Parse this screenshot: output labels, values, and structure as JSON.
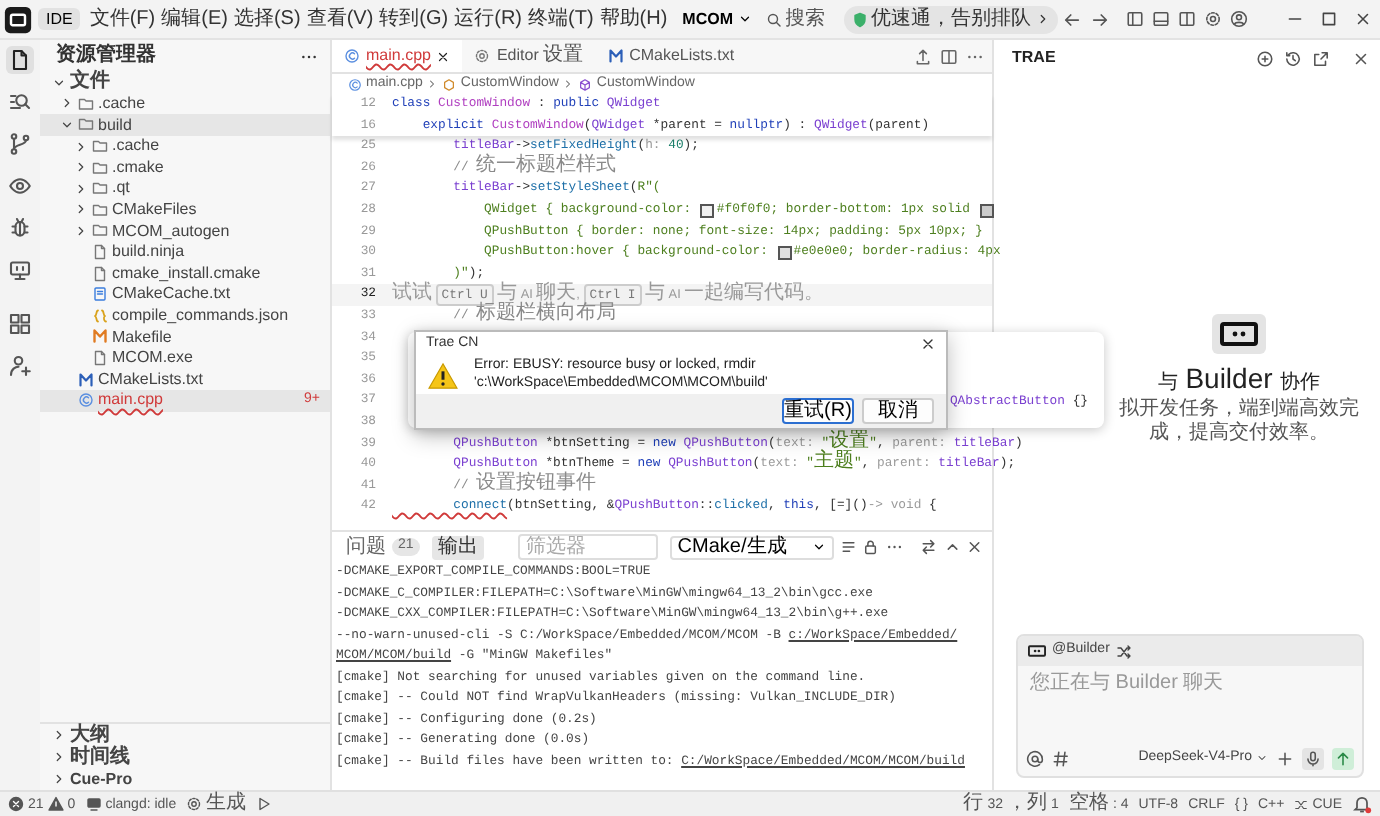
{
  "title_bar": {
    "app_label": "IDE",
    "menus": [
      "文件(F)",
      "编辑(E)",
      "选择(S)",
      "查看(V)",
      "转到(G)",
      "运行(R)",
      "终端(T)",
      "帮助(H)"
    ],
    "project": "MCOM",
    "search_placeholder": "搜索",
    "promo": "优速通，告别排队"
  },
  "activity_bar": [
    {
      "selected": true
    },
    {
      "selected": false
    },
    {
      "selected": false
    },
    {
      "selected": false
    },
    {
      "selected": false
    },
    {
      "selected": false
    },
    {
      "selected": false
    },
    {
      "selected": false
    }
  ],
  "sidebar": {
    "title": "资源管理器",
    "section": "文件",
    "tree": [
      {
        "label": ".cache",
        "kind": "folder",
        "expanded": false,
        "selected": false
      },
      {
        "label": "build",
        "kind": "folder",
        "expanded": true,
        "selected": true,
        "children": [
          {
            "label": ".cache",
            "kind": "folder",
            "expanded": false,
            "selected": false
          },
          {
            "label": ".cmake",
            "kind": "folder",
            "expanded": false,
            "selected": false
          },
          {
            "label": ".qt",
            "kind": "folder",
            "expanded": false,
            "selected": false
          },
          {
            "label": "CMakeFiles",
            "kind": "folder",
            "expanded": false,
            "selected": false
          },
          {
            "label": "MCOM_autogen",
            "kind": "folder",
            "expanded": false,
            "selected": false
          },
          {
            "label": "build.ninja",
            "kind": "plain",
            "selected": false
          },
          {
            "label": "cmake_install.cmake",
            "kind": "plain",
            "selected": false
          },
          {
            "label": "CMakeCache.txt",
            "kind": "cache",
            "selected": false
          },
          {
            "label": "compile_commands.json",
            "kind": "json",
            "selected": false
          },
          {
            "label": "Makefile",
            "kind": "make",
            "selected": false
          },
          {
            "label": "MCOM.exe",
            "kind": "plain",
            "selected": false
          }
        ]
      },
      {
        "label": "CMakeLists.txt",
        "kind": "cmake",
        "selected": false
      },
      {
        "label": "main.cpp",
        "kind": "cpp",
        "selected": true,
        "error": true,
        "badge": "9+"
      }
    ],
    "panels": [
      "大纲",
      "时间线",
      "Cue-Pro"
    ]
  },
  "editor": {
    "tabs": [
      {
        "label": "main.cpp",
        "kind": "cpp",
        "selected": true,
        "error": true
      },
      {
        "label": "Editor 设置",
        "kind": "settings",
        "selected": false,
        "error": false
      },
      {
        "label": "CMakeLists.txt",
        "kind": "cmake",
        "selected": false,
        "error": false
      }
    ],
    "breadcrumb": [
      "main.cpp",
      "CustomWindow",
      "CustomWindow"
    ],
    "sticky_lines": [
      {
        "number": "12",
        "segments": [
          {
            "text": "class ",
            "kind": "kw"
          },
          {
            "text": "CustomWindow",
            "kind": "cls"
          },
          {
            "text": " : ",
            "kind": "plain"
          },
          {
            "text": "public ",
            "kind": "kw"
          },
          {
            "text": "QWidget",
            "kind": "type"
          }
        ]
      },
      {
        "number": "16",
        "segments": [
          {
            "text": "    explicit ",
            "kind": "kw"
          },
          {
            "text": "CustomWindow",
            "kind": "cls"
          },
          {
            "text": "(",
            "kind": "plain"
          },
          {
            "text": "QWidget",
            "kind": "type"
          },
          {
            "text": " *parent = ",
            "kind": "plain"
          },
          {
            "text": "nullptr",
            "kind": "kw"
          },
          {
            "text": ") : ",
            "kind": "plain"
          },
          {
            "text": "QWidget",
            "kind": "type"
          },
          {
            "text": "(parent)",
            "kind": "plain"
          }
        ]
      }
    ],
    "lines": [
      {
        "number": "25",
        "current": false,
        "segments": [
          {
            "text": "        titleBar",
            "kind": "var"
          },
          {
            "text": "->",
            "kind": "plain"
          },
          {
            "text": "setFixedHeight",
            "kind": "fn"
          },
          {
            "text": "(",
            "kind": "plain"
          },
          {
            "text": "h: ",
            "kind": "hint"
          },
          {
            "text": "40",
            "kind": "num"
          },
          {
            "text": ");",
            "kind": "plain"
          }
        ]
      },
      {
        "number": "26",
        "current": false,
        "segments": [
          {
            "text": "        // 统一标题栏样式",
            "kind": "comment"
          }
        ]
      },
      {
        "number": "27",
        "current": false,
        "segments": [
          {
            "text": "        titleBar",
            "kind": "var"
          },
          {
            "text": "->",
            "kind": "plain"
          },
          {
            "text": "setStyleSheet",
            "kind": "fn"
          },
          {
            "text": "(",
            "kind": "plain"
          },
          {
            "text": "R\"(",
            "kind": "str"
          }
        ]
      },
      {
        "number": "28",
        "current": false,
        "segments": [
          {
            "text": "            QWidget { background-color: ",
            "kind": "str"
          },
          {
            "kind": "swatch",
            "color": "#f0f0f0"
          },
          {
            "text": "#f0f0f0; border-bottom: 1px solid ",
            "kind": "str"
          },
          {
            "kind": "swatch",
            "color": "#cccccc"
          }
        ]
      },
      {
        "number": "29",
        "current": false,
        "segments": [
          {
            "text": "            QPushButton { border: none; font-size: 14px; padding: 5px 10px; }",
            "kind": "str"
          }
        ]
      },
      {
        "number": "30",
        "current": false,
        "segments": [
          {
            "text": "            QPushButton:hover { background-color: ",
            "kind": "str"
          },
          {
            "kind": "swatch",
            "color": "#e0e0e0"
          },
          {
            "text": "#e0e0e0; border-radius: 4px",
            "kind": "str"
          }
        ]
      },
      {
        "number": "31",
        "current": false,
        "segments": [
          {
            "text": "        )\"",
            "kind": "str"
          },
          {
            "text": ");",
            "kind": "plain"
          }
        ]
      },
      {
        "number": "32",
        "current": true,
        "segments": [
          {
            "text": "试试 ",
            "kind": "ghost"
          },
          {
            "text": "Ctrl U",
            "kind": "key"
          },
          {
            "text": " 与 AI 聊天, ",
            "kind": "ghost"
          },
          {
            "text": "Ctrl I",
            "kind": "key"
          },
          {
            "text": " 与 AI 一起编写代码。",
            "kind": "ghost"
          }
        ]
      },
      {
        "number": "33",
        "current": false,
        "segments": [
          {
            "text": "        // 标题栏横向布局",
            "kind": "comment"
          }
        ]
      },
      {
        "number": "34",
        "current": false
      },
      {
        "number": "35",
        "current": false
      },
      {
        "number": "36",
        "current": false
      },
      {
        "number": "37",
        "current": false
      },
      {
        "number": "38",
        "current": false
      },
      {
        "number": "39",
        "current": false,
        "segments": [
          {
            "text": "        QPushButton",
            "kind": "type"
          },
          {
            "text": " *btnSetting = ",
            "kind": "plain"
          },
          {
            "text": "new ",
            "kind": "kw"
          },
          {
            "text": "QPushButton",
            "kind": "type"
          },
          {
            "text": "(",
            "kind": "plain"
          },
          {
            "text": "text: ",
            "kind": "hint"
          },
          {
            "text": "\"设置\"",
            "kind": "str"
          },
          {
            "text": ", ",
            "kind": "plain"
          },
          {
            "text": "parent: ",
            "kind": "hint"
          },
          {
            "text": "titleBar",
            "kind": "var"
          },
          {
            "text": ")",
            "kind": "plain"
          }
        ]
      },
      {
        "number": "40",
        "current": false,
        "segments": [
          {
            "text": "        QPushButton",
            "kind": "type"
          },
          {
            "text": " *btnTheme = ",
            "kind": "plain"
          },
          {
            "text": "new ",
            "kind": "kw"
          },
          {
            "text": "QPushButton",
            "kind": "type"
          },
          {
            "text": "(",
            "kind": "plain"
          },
          {
            "text": "text: ",
            "kind": "hint"
          },
          {
            "text": "\"主题\"",
            "kind": "str"
          },
          {
            "text": ", ",
            "kind": "plain"
          },
          {
            "text": "parent: ",
            "kind": "hint"
          },
          {
            "text": "titleBar",
            "kind": "var"
          },
          {
            "text": ");",
            "kind": "plain"
          }
        ]
      },
      {
        "number": "41",
        "current": false,
        "segments": [
          {
            "text": "        // 设置按钮事件",
            "kind": "comment"
          }
        ]
      },
      {
        "number": "42",
        "current": false,
        "segments": [
          {
            "text": "        connect",
            "kind": "fn",
            "error": true
          },
          {
            "text": "(btnSetting, &",
            "kind": "plain"
          },
          {
            "text": "QPushButton",
            "kind": "type"
          },
          {
            "text": "::",
            "kind": "plain"
          },
          {
            "text": "clicked",
            "kind": "fn"
          },
          {
            "text": ", ",
            "kind": "plain"
          },
          {
            "text": "this",
            "kind": "kw"
          },
          {
            "text": ", [=]()",
            "kind": "plain"
          },
          {
            "text": "-> void",
            "kind": "hint"
          },
          {
            "text": " {",
            "kind": "plain"
          }
        ]
      }
    ],
    "peek": [
      {
        "text": "QAbstractButton",
        "kind": "type"
      },
      {
        "text": " {}",
        "kind": "plain"
      }
    ]
  },
  "dialog": {
    "title": "Trae CN",
    "message": [
      "Error: EBUSY: resource busy or locked, rmdir",
      "'c:\\WorkSpace\\Embedded\\MCOM\\MCOM\\build'"
    ],
    "buttons": [
      {
        "label": "重试(R)",
        "default": true
      },
      {
        "label": "取消",
        "default": false
      }
    ]
  },
  "panel": {
    "tabs": [
      {
        "label": "问题",
        "count": "21",
        "selected": false
      },
      {
        "label": "输出",
        "selected": true
      }
    ],
    "filter_placeholder": "筛选器",
    "channel": "CMake/生成",
    "output": [
      [
        {
          "text": "-DCMAKE_EXPORT_COMPILE_COMMANDS:BOOL=TRUE",
          "link": false
        }
      ],
      [
        {
          "text": "-DCMAKE_C_COMPILER:FILEPATH=C:\\Software\\MinGW\\mingw64_13_2\\bin\\gcc.exe",
          "link": false
        }
      ],
      [
        {
          "text": "-DCMAKE_CXX_COMPILER:FILEPATH=C:\\Software\\MinGW\\mingw64_13_2\\bin\\g++.exe",
          "link": false
        }
      ],
      [
        {
          "text": "--no-warn-unused-cli -S C:/WorkSpace/Embedded/MCOM/MCOM -B ",
          "link": false
        },
        {
          "text": "c:/WorkSpace/Embedded/",
          "link": true
        }
      ],
      [
        {
          "text": "MCOM/MCOM/build",
          "link": true
        },
        {
          "text": " -G \"MinGW Makefiles\"",
          "link": false
        }
      ],
      [
        {
          "text": "[cmake] Not searching for unused variables given on the command line.",
          "link": false
        }
      ],
      [
        {
          "text": "[cmake] -- Could NOT find WrapVulkanHeaders (missing: Vulkan_INCLUDE_DIR)",
          "link": false
        }
      ],
      [
        {
          "text": "[cmake] -- Configuring done (0.2s)",
          "link": false
        }
      ],
      [
        {
          "text": "[cmake] -- Generating done (0.0s)",
          "link": false
        }
      ],
      [
        {
          "text": "[cmake] -- Build files have been written to: ",
          "link": false
        },
        {
          "text": "C:/WorkSpace/Embedded/MCOM/MCOM/build",
          "link": true
        }
      ]
    ]
  },
  "assistant": {
    "title": "TRAE",
    "heading": "与 Builder 协作",
    "description": "拟开发任务，端到端高效完成，提高交付效率。",
    "chat": {
      "agent": "@Builder",
      "placeholder": "您正在与 Builder 聊天",
      "model": "DeepSeek-V4-Pro"
    }
  },
  "status_bar": {
    "errors": "21",
    "warnings": "0",
    "language_server": "clangd: idle",
    "build": "生成",
    "items": [
      "行 32，列 1",
      "空格: 4",
      "UTF-8",
      "CRLF",
      "{ }",
      "C++",
      "CUE"
    ]
  }
}
